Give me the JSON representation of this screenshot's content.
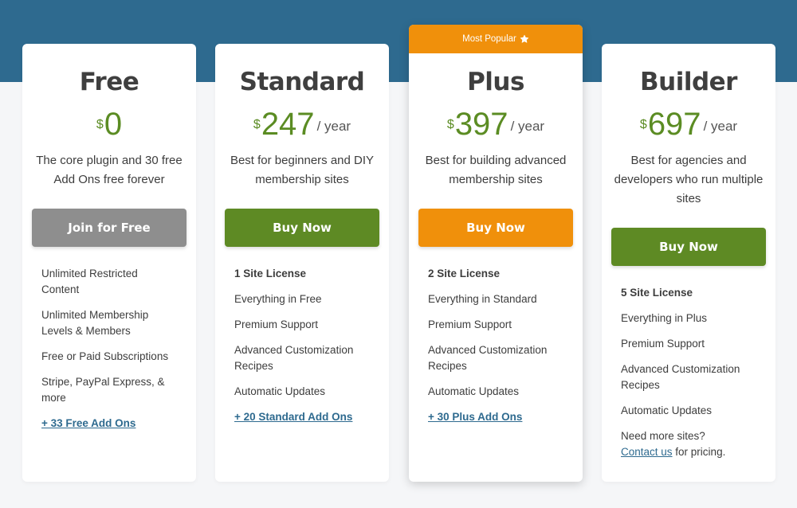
{
  "colors": {
    "hero_band": "#2e6a8f",
    "price_green": "#5b8c23",
    "button_gray": "#8e8e8e",
    "button_green": "#5e8a24",
    "accent_orange": "#f0900b",
    "link_blue": "#2e6a8f"
  },
  "plans": [
    {
      "name": "Free",
      "currency": "$",
      "amount": "0",
      "period": "",
      "description": "The core plugin and 30 free Add Ons free forever",
      "cta_label": "Join for Free",
      "features": [
        "Unlimited Restricted Content",
        "Unlimited Membership Levels & Members",
        "Free or Paid Subscriptions",
        "Stripe, PayPal Express, & more"
      ],
      "addon_link": "+ 33 Free Add Ons"
    },
    {
      "name": "Standard",
      "currency": "$",
      "amount": "247",
      "period": "/ year",
      "description": "Best for beginners and DIY membership sites",
      "cta_label": "Buy Now",
      "license": "1 Site License",
      "features": [
        "Everything in Free",
        "Premium Support",
        "Advanced Customization Recipes",
        "Automatic Updates"
      ],
      "addon_link": "+ 20 Standard Add Ons"
    },
    {
      "badge": "Most Popular",
      "badge_icon": "star-icon",
      "name": "Plus",
      "currency": "$",
      "amount": "397",
      "period": "/ year",
      "description": "Best for building advanced membership sites",
      "cta_label": "Buy Now",
      "license": "2 Site License",
      "features": [
        "Everything in Standard",
        "Premium Support",
        "Advanced Customization Recipes",
        "Automatic Updates"
      ],
      "addon_link": "+ 30 Plus Add Ons"
    },
    {
      "name": "Builder",
      "currency": "$",
      "amount": "697",
      "period": "/ year",
      "description": "Best for agencies and developers who run multiple sites",
      "cta_label": "Buy Now",
      "license": "5 Site License",
      "features": [
        "Everything in Plus",
        "Premium Support",
        "Advanced Customization Recipes",
        "Automatic Updates"
      ],
      "more_sites_text": "Need more sites?",
      "contact_link": "Contact us",
      "contact_suffix": " for pricing."
    }
  ]
}
